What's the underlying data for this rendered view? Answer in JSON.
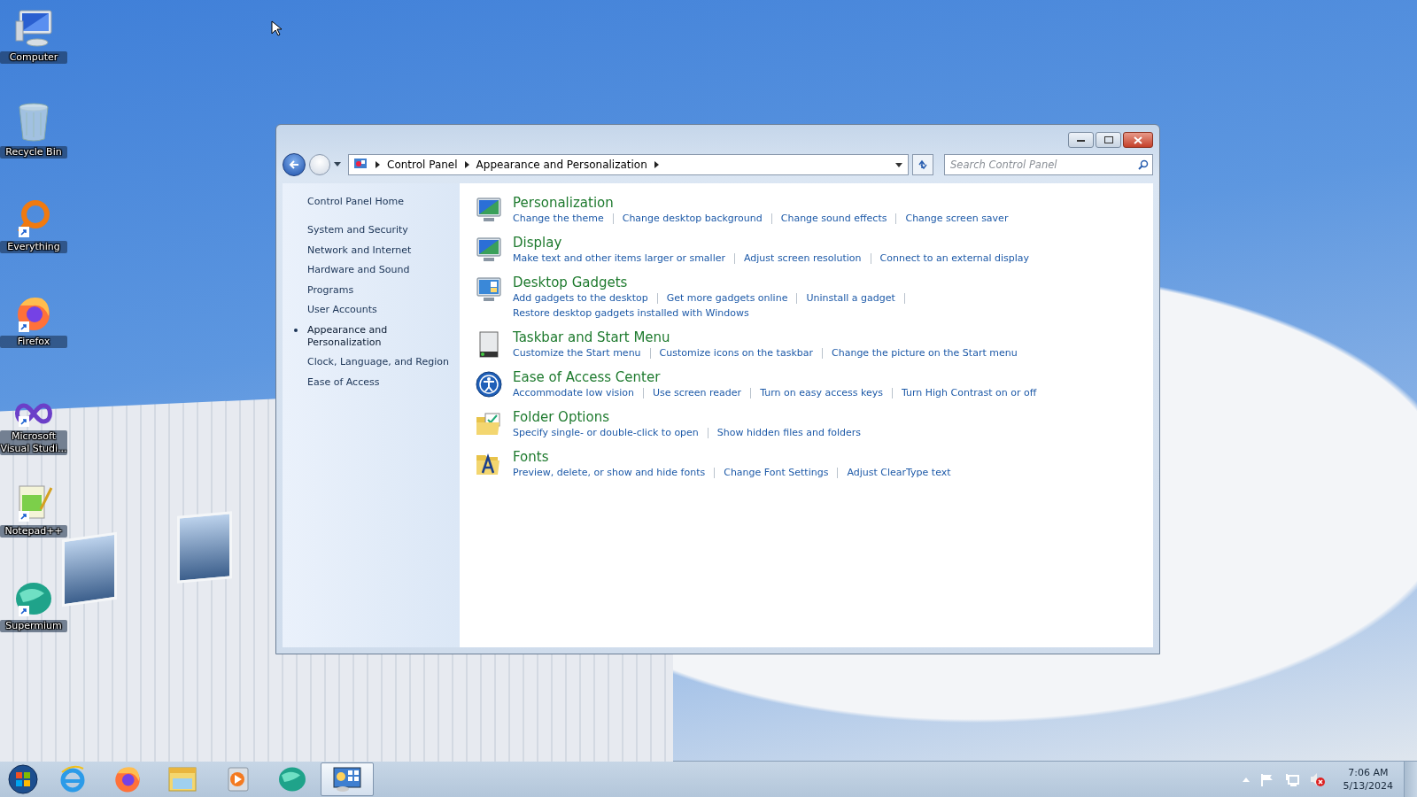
{
  "desktop_icons": [
    {
      "label": "Computer",
      "kind": "computer",
      "shortcut": false
    },
    {
      "label": "Recycle Bin",
      "kind": "bin",
      "shortcut": false
    },
    {
      "label": "Everything",
      "kind": "ring",
      "shortcut": true
    },
    {
      "label": "Firefox",
      "kind": "firefox",
      "shortcut": true
    },
    {
      "label": "Microsoft Visual Studi...",
      "kind": "infinity",
      "shortcut": true
    },
    {
      "label": "Notepad++",
      "kind": "notepad",
      "shortcut": true
    },
    {
      "label": "Supermium",
      "kind": "sphere",
      "shortcut": true
    }
  ],
  "window": {
    "address": {
      "crumbs": [
        "Control Panel",
        "Appearance and Personalization"
      ]
    },
    "search": {
      "placeholder": "Search Control Panel"
    },
    "sidebar": {
      "items": [
        {
          "label": "Control Panel Home",
          "selected": false
        },
        {
          "label": "System and Security",
          "selected": false
        },
        {
          "label": "Network and Internet",
          "selected": false
        },
        {
          "label": "Hardware and Sound",
          "selected": false
        },
        {
          "label": "Programs",
          "selected": false
        },
        {
          "label": "User Accounts",
          "selected": false
        },
        {
          "label": "Appearance and Personalization",
          "selected": true
        },
        {
          "label": "Clock, Language, and Region",
          "selected": false
        },
        {
          "label": "Ease of Access",
          "selected": false
        }
      ]
    },
    "sections": [
      {
        "title": "Personalization",
        "kind": "monitor",
        "lines": [
          [
            "Change the theme",
            "Change desktop background",
            "Change sound effects",
            "Change screen saver"
          ]
        ]
      },
      {
        "title": "Display",
        "kind": "monitor",
        "lines": [
          [
            "Make text and other items larger or smaller",
            "Adjust screen resolution",
            "Connect to an external display"
          ]
        ]
      },
      {
        "title": "Desktop Gadgets",
        "kind": "gadget",
        "lines": [
          [
            "Add gadgets to the desktop",
            "Get more gadgets online",
            "Uninstall a gadget"
          ],
          [
            "Restore desktop gadgets installed with Windows"
          ]
        ]
      },
      {
        "title": "Taskbar and Start Menu",
        "kind": "taskbar",
        "lines": [
          [
            "Customize the Start menu",
            "Customize icons on the taskbar",
            "Change the picture on the Start menu"
          ]
        ]
      },
      {
        "title": "Ease of Access Center",
        "kind": "access",
        "lines": [
          [
            "Accommodate low vision",
            "Use screen reader",
            "Turn on easy access keys",
            "Turn High Contrast on or off"
          ]
        ]
      },
      {
        "title": "Folder Options",
        "kind": "folder",
        "lines": [
          [
            "Specify single- or double-click to open",
            "Show hidden files and folders"
          ]
        ]
      },
      {
        "title": "Fonts",
        "kind": "fonts",
        "lines": [
          [
            "Preview, delete, or show and hide fonts",
            "Change Font Settings",
            "Adjust ClearType text"
          ]
        ]
      }
    ]
  },
  "taskbar": {
    "apps": [
      {
        "kind": "ie",
        "selected": false
      },
      {
        "kind": "firefox",
        "selected": false
      },
      {
        "kind": "explorer",
        "selected": false
      },
      {
        "kind": "player",
        "selected": false
      },
      {
        "kind": "sphere",
        "selected": false
      },
      {
        "kind": "controlpanel",
        "selected": true
      }
    ],
    "clock": {
      "time": "7:06 AM",
      "date": "5/13/2024"
    }
  }
}
